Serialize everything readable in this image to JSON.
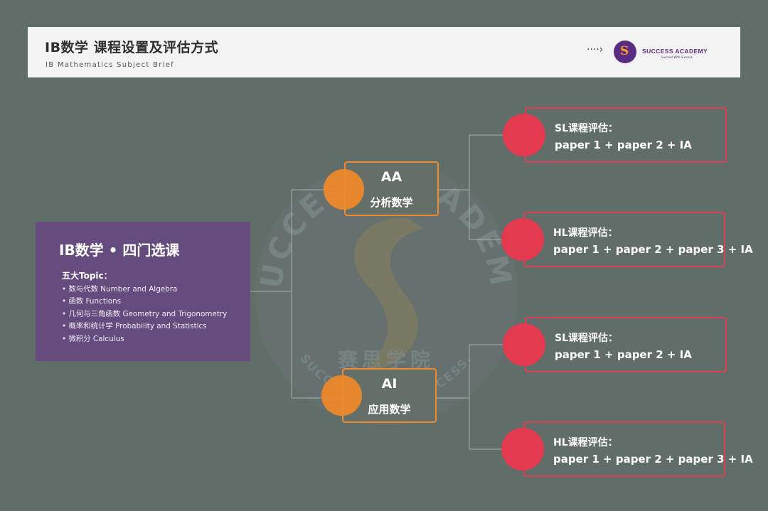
{
  "header": {
    "title": "IB数学  课程设置及评估方式",
    "subtitle": "IB Mathematics Subject Brief",
    "arrow": "····›",
    "logo_letter": "S",
    "brand": "SUCCESS ACADEMY",
    "tagline": "Success With Success"
  },
  "main_card": {
    "title": "IB数学 • 四门选课",
    "topics_label": "五大Topic：",
    "topics": [
      "数与代数 Number and Algebra",
      "函数 Functions",
      "几何与三角函数 Geometry and Trigonometry",
      "概率和统计学 Probability and Statistics",
      "微积分 Calculus"
    ]
  },
  "courses": [
    {
      "code": "AA",
      "name": "分析数学"
    },
    {
      "code": "AI",
      "name": "应用数学"
    }
  ],
  "assessments": [
    {
      "level": "SL课程评估：",
      "formula": "paper 1 + paper 2 + IA"
    },
    {
      "level": "HL课程评估：",
      "formula": "paper 1 + paper 2 + paper 3 + IA"
    },
    {
      "level": "SL课程评估：",
      "formula": "paper 1 + paper 2 + IA"
    },
    {
      "level": "HL课程评估：",
      "formula": "paper 1 + paper 2 + paper 3 + IA"
    }
  ],
  "watermark": {
    "arc_text": "SUCCESS ACADEMY",
    "chinese": "赛思学院",
    "bottom_text": "SUCCESS WITH SUCCESS."
  },
  "colors": {
    "background": "#616d69",
    "card": "#664c7e",
    "orange": "#f0892a",
    "red": "#e43a50",
    "brand_purple": "#5b2d82"
  }
}
